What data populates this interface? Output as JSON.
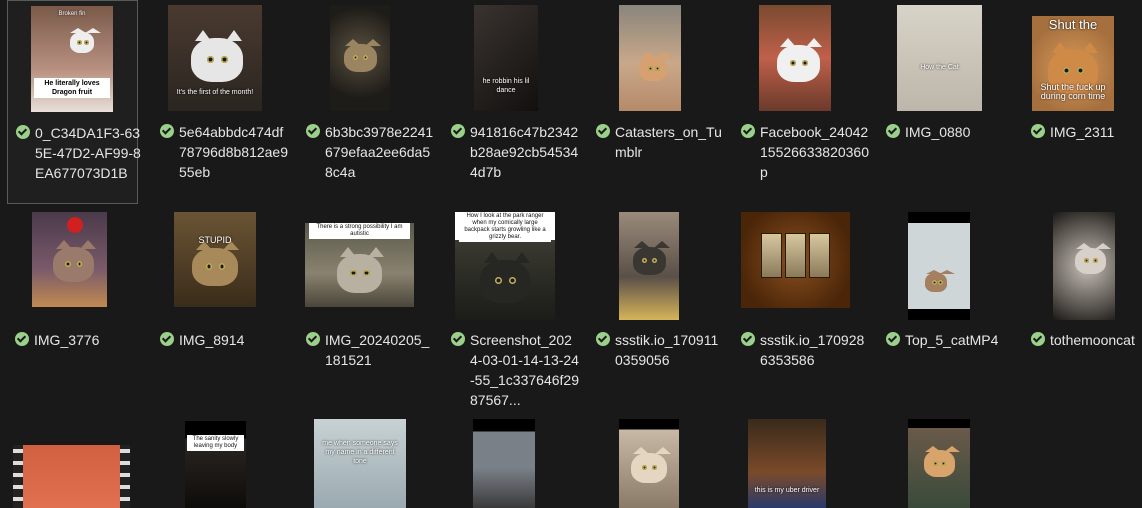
{
  "items": [
    {
      "name": "0_C34DA1F3-635E-47D2-AF99-8EA677073D1B",
      "selected": true,
      "synced": true,
      "kind": "cat-dragon",
      "captions": [
        "Broken fin",
        "He literally loves\nDragon fruit"
      ]
    },
    {
      "name": "5e64abbdc474df78796d8b812ae955eb",
      "synced": true,
      "kind": "cat-white",
      "captions": [
        "It's the first of the month!"
      ]
    },
    {
      "name": "6b3bc3978e2241679efaa2ee6da58c4a",
      "synced": true,
      "kind": "cat-tabby",
      "captions": []
    },
    {
      "name": "941816c47b2342b28ae92cb545344d7b",
      "synced": true,
      "kind": "dark-room",
      "captions": [
        "he robbin his lil dance"
      ]
    },
    {
      "name": "Catasters_on_Tumblr",
      "synced": true,
      "kind": "couch",
      "captions": []
    },
    {
      "name": "Facebook_2404215526633820360p",
      "synced": true,
      "kind": "cat-tuxedo",
      "captions": []
    },
    {
      "name": "IMG_0880",
      "synced": true,
      "kind": "bathroom",
      "captions": [
        "How the Cat"
      ]
    },
    {
      "name": "IMG_2311",
      "synced": true,
      "kind": "cat-orange-meme",
      "captions": [
        "Shut the",
        "Shut the fuck up during corn time"
      ]
    },
    {
      "name": "IMG_3776",
      "synced": true,
      "kind": "cat-apple",
      "captions": []
    },
    {
      "name": "IMG_8914",
      "synced": true,
      "kind": "cat-stupid",
      "captions": [
        "STUPID"
      ]
    },
    {
      "name": "IMG_20240205_181521",
      "synced": true,
      "kind": "cat-autistic",
      "captions": [
        "There is a strong possibility I am autistic"
      ]
    },
    {
      "name": "Screenshot_2024-03-01-14-13-24-55_1c337646f2987567...",
      "synced": true,
      "kind": "cat-black",
      "captions": [
        "How I look at the park ranger when my comically large backpack starts growling like a grizzly bear."
      ]
    },
    {
      "name": "ssstik.io_1709110359056",
      "synced": true,
      "kind": "cat-outdoor",
      "captions": []
    },
    {
      "name": "ssstik.io_1709286353586",
      "synced": true,
      "kind": "slot",
      "captions": []
    },
    {
      "name": "Top_5_catMP4",
      "synced": true,
      "kind": "cat-small",
      "captions": []
    },
    {
      "name": "tothemooncat",
      "synced": true,
      "kind": "cat-moon",
      "captions": []
    },
    {
      "name": "",
      "synced": false,
      "kind": "film",
      "captions": []
    },
    {
      "name": "",
      "synced": false,
      "kind": "dark-cap",
      "captions": [
        "The sanity slowly leaving my body"
      ]
    },
    {
      "name": "",
      "synced": false,
      "kind": "shower",
      "captions": [
        "me when someone says my name in a different tone"
      ]
    },
    {
      "name": "",
      "synced": false,
      "kind": "street",
      "captions": []
    },
    {
      "name": "",
      "synced": false,
      "kind": "cat-pale",
      "captions": []
    },
    {
      "name": "",
      "synced": false,
      "kind": "toy",
      "captions": [
        "this is my uber driver"
      ]
    },
    {
      "name": "",
      "synced": false,
      "kind": "kitten-green",
      "captions": []
    }
  ],
  "colors": {
    "background": "#191919",
    "text": "#e6e6e6",
    "sync": "#9bd08a"
  }
}
